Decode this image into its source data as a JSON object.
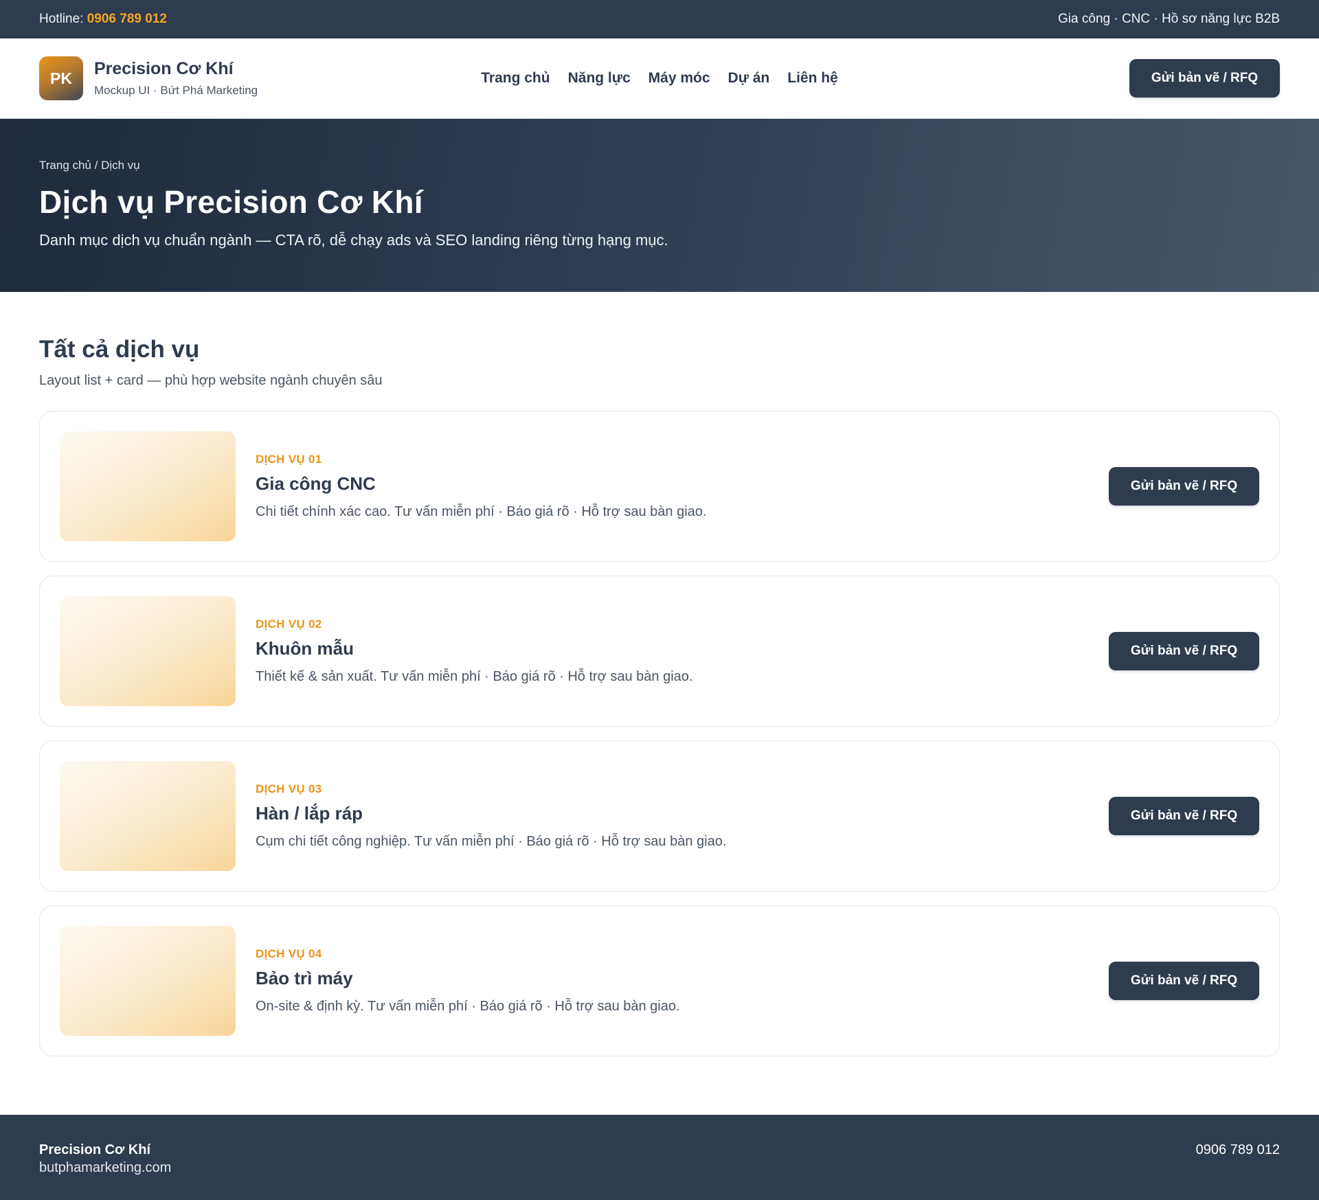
{
  "topbar": {
    "hotline_label": "Hotline:",
    "hotline_number": "0906 789 012",
    "tagline": "Gia công · CNC · Hồ sơ năng lực B2B"
  },
  "header": {
    "logo_text": "PK",
    "brand_name": "Precision Cơ Khí",
    "brand_sub": "Mockup UI · Bứt Phá Marketing",
    "nav": [
      "Trang chủ",
      "Năng lực",
      "Máy móc",
      "Dự án",
      "Liên hệ"
    ],
    "cta_label": "Gửi bản vẽ / RFQ"
  },
  "hero": {
    "breadcrumb": "Trang chủ / Dịch vụ",
    "title": "Dịch vụ Precision Cơ Khí",
    "subtitle": "Danh mục dịch vụ chuẩn ngành — CTA rõ, dễ chạy ads và SEO landing riêng từng hạng mục."
  },
  "section": {
    "title": "Tất cả dịch vụ",
    "subtitle": "Layout list + card — phù hợp website ngành chuyên sâu"
  },
  "services": [
    {
      "label": "DỊCH VỤ 01",
      "title": "Gia công CNC",
      "desc": "Chi tiết chính xác cao. Tư vấn miễn phí · Báo giá rõ · Hỗ trợ sau bàn giao.",
      "cta": "Gửi bản vẽ / RFQ"
    },
    {
      "label": "DỊCH VỤ 02",
      "title": "Khuôn mẫu",
      "desc": "Thiết kế & sản xuất. Tư vấn miễn phí · Báo giá rõ · Hỗ trợ sau bàn giao.",
      "cta": "Gửi bản vẽ / RFQ"
    },
    {
      "label": "DỊCH VỤ 03",
      "title": "Hàn / lắp ráp",
      "desc": "Cụm chi tiết công nghiệp. Tư vấn miễn phí · Báo giá rõ · Hỗ trợ sau bàn giao.",
      "cta": "Gửi bản vẽ / RFQ"
    },
    {
      "label": "DỊCH VỤ 04",
      "title": "Bảo trì máy",
      "desc": "On-site & định kỳ. Tư vấn miễn phí · Báo giá rõ · Hỗ trợ sau bàn giao.",
      "cta": "Gửi bản vẽ / RFQ"
    }
  ],
  "footer": {
    "brand_name": "Precision Cơ Khí",
    "website": "butphamarketing.com",
    "phone": "0906 789 012"
  },
  "colors": {
    "primary_dark": "#2f3b4f",
    "accent": "#e8951a"
  }
}
